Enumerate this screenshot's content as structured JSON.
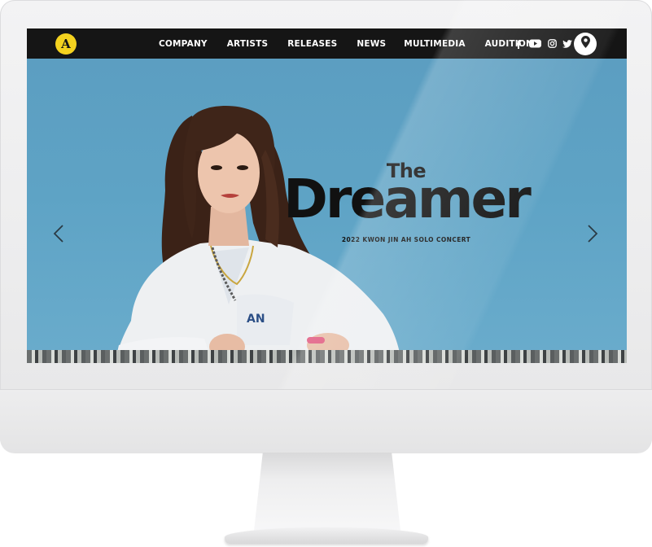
{
  "site": {
    "logo_text": "A",
    "logo_color": "#f4d21f"
  },
  "nav": {
    "items": [
      {
        "label": "COMPANY"
      },
      {
        "label": "ARTISTS"
      },
      {
        "label": "RELEASES"
      },
      {
        "label": "NEWS"
      },
      {
        "label": "MULTIMEDIA"
      },
      {
        "label": "AUDITION"
      }
    ],
    "social_icons": [
      "facebook-icon",
      "youtube-icon",
      "instagram-icon",
      "twitter-icon"
    ],
    "location_icon": "map-pin-icon",
    "background": "#151515"
  },
  "hero": {
    "title_small": "The",
    "title_large": "Dreamer",
    "subtitle": "2022 KWON JIN AH SOLO CONCERT",
    "background": "#5d9fc1",
    "prev_icon": "chevron-left-icon",
    "next_icon": "chevron-right-icon"
  }
}
